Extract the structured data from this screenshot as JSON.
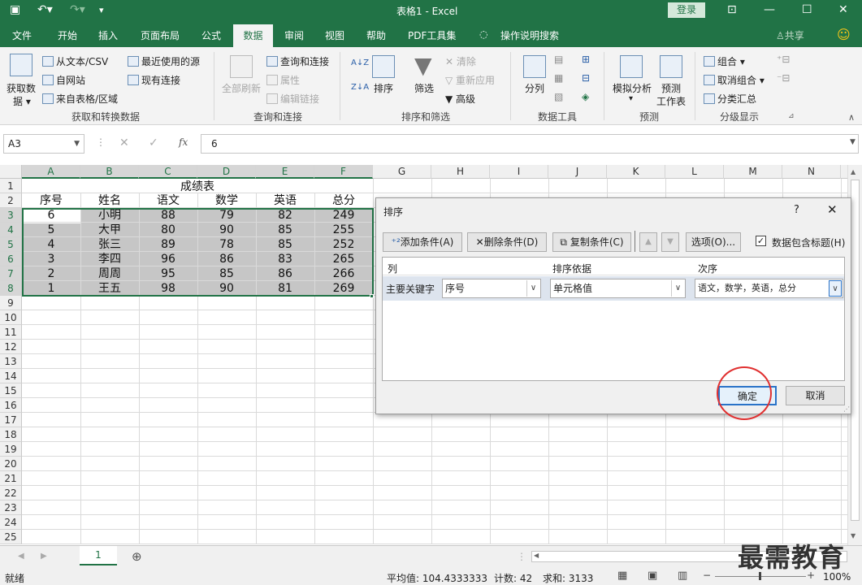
{
  "window": {
    "title": "表格1 - Excel",
    "login": "登录"
  },
  "tabs": [
    "文件",
    "开始",
    "插入",
    "页面布局",
    "公式",
    "数据",
    "审阅",
    "视图",
    "帮助",
    "PDF工具集"
  ],
  "tell_me": "操作说明搜索",
  "share": "共享",
  "ribbon": {
    "get_data": {
      "line1": "获取数",
      "line2": "据 ▾",
      "from_text": "从文本/CSV",
      "from_web": "自网站",
      "from_table": "来自表格/区域",
      "recent": "最近使用的源",
      "existing": "现有连接",
      "group": "获取和转换数据"
    },
    "queries": {
      "refresh_all": "全部刷新",
      "queries_conn": "查询和连接",
      "properties": "属性",
      "edit_links": "编辑链接",
      "group": "查询和连接"
    },
    "sort_filter": {
      "sort": "排序",
      "filter": "筛选",
      "clear": "清除",
      "reapply": "重新应用",
      "advanced": "高级",
      "group": "排序和筛选"
    },
    "data_tools": {
      "split": "分列",
      "group": "数据工具"
    },
    "forecast": {
      "whatif": "模拟分析",
      "sheet_l1": "预测",
      "sheet_l2": "工作表",
      "group": "预测"
    },
    "outline": {
      "group_btn": "组合 ▾",
      "ungroup": "取消组合 ▾",
      "subtotal": "分类汇总",
      "group": "分级显示"
    }
  },
  "formula_bar": {
    "name_box": "A3",
    "value": "6"
  },
  "columns": [
    "A",
    "B",
    "C",
    "D",
    "E",
    "F",
    "G",
    "H",
    "I",
    "J",
    "K",
    "L",
    "M",
    "N"
  ],
  "rows": [
    "1",
    "2",
    "3",
    "4",
    "5",
    "6",
    "7",
    "8",
    "9",
    "10",
    "11",
    "12",
    "13",
    "14",
    "15",
    "16",
    "17",
    "18",
    "19",
    "20",
    "21",
    "22",
    "23",
    "24",
    "25"
  ],
  "sheet": {
    "title": "成绩表",
    "headers": [
      "序号",
      "姓名",
      "语文",
      "数学",
      "英语",
      "总分"
    ],
    "data": [
      [
        "6",
        "小明",
        "88",
        "79",
        "82",
        "249"
      ],
      [
        "5",
        "大甲",
        "80",
        "90",
        "85",
        "255"
      ],
      [
        "4",
        "张三",
        "89",
        "78",
        "85",
        "252"
      ],
      [
        "3",
        "李四",
        "96",
        "86",
        "83",
        "265"
      ],
      [
        "2",
        "周周",
        "95",
        "85",
        "86",
        "266"
      ],
      [
        "1",
        "王五",
        "98",
        "90",
        "81",
        "269"
      ]
    ]
  },
  "sheet_tab": "1",
  "status": {
    "ready": "就绪",
    "average": "平均值: 104.4333333",
    "count": "计数: 42",
    "sum": "求和: 3133",
    "zoom": "100%"
  },
  "dialog": {
    "title": "排序",
    "help": "?",
    "add": "添加条件(A)",
    "delete": "删除条件(D)",
    "copy": "复制条件(C)",
    "options": "选项(O)...",
    "header_checkbox": "数据包含标题(H)",
    "col_header": "列",
    "sorton_header": "排序依据",
    "order_header": "次序",
    "primary_key": "主要关键字",
    "column_value": "序号",
    "sorton_value": "单元格值",
    "order_value": "语文，数学，英语，总分",
    "ok": "确定",
    "cancel": "取消"
  },
  "watermark": "最需教育",
  "colors": {
    "excel_green": "#217346",
    "highlight_circle": "#e03030"
  }
}
